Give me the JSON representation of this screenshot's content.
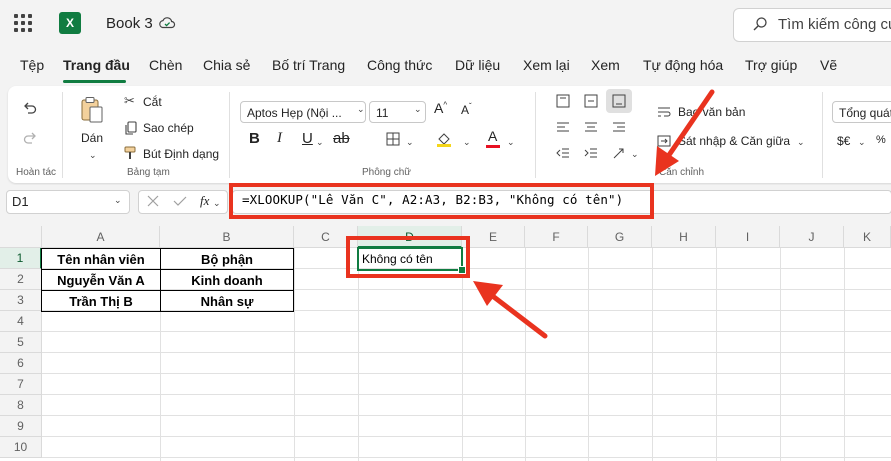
{
  "titlebar": {
    "book_title": "Book 3",
    "search_placeholder": "Tìm kiếm công cụ,"
  },
  "tabs": [
    {
      "label": "Tệp"
    },
    {
      "label": "Trang đầu",
      "active": true
    },
    {
      "label": "Chèn"
    },
    {
      "label": "Chia sẻ"
    },
    {
      "label": "Bố trí Trang"
    },
    {
      "label": "Công thức"
    },
    {
      "label": "Dữ liệu"
    },
    {
      "label": "Xem lại"
    },
    {
      "label": "Xem"
    },
    {
      "label": "Tự động hóa"
    },
    {
      "label": "Trợ giúp"
    },
    {
      "label": "Vẽ"
    }
  ],
  "ribbon": {
    "undo_group_label": "Hoàn tác",
    "paste_label": "Dán",
    "cut_label": "Cắt",
    "copy_label": "Sao chép",
    "format_painter_label": "Bút Định dạng",
    "clipboard_group_label": "Bảng tạm",
    "font_name": "Aptos Hẹp (Nội ...",
    "font_size": "11",
    "font_group_label": "Phông chữ",
    "wrap_text_label": "Bao văn bản",
    "merge_center_label": "Sát nhập & Căn giữa",
    "alignment_group_label": "Căn chỉnh",
    "number_format": "Tổng quát",
    "currency_label": "$€"
  },
  "formula_bar": {
    "name_box": "D1",
    "fx_label": "fx",
    "formula": "=XLOOKUP(\"Lê Văn C\", A2:A3, B2:B3, \"Không có tên\")"
  },
  "grid": {
    "columns": [
      "A",
      "B",
      "C",
      "D",
      "E",
      "F",
      "G",
      "H",
      "I",
      "J",
      "K"
    ],
    "selected_column": "D",
    "rows": [
      "1",
      "2",
      "3",
      "4",
      "5",
      "6",
      "7",
      "8",
      "9",
      "10"
    ],
    "selected_row": "1",
    "cells": {
      "A1": "Tên nhân viên",
      "B1": "Bộ phận",
      "A2": "Nguyễn Văn A",
      "B2": "Kinh doanh",
      "A3": "Trần Thị B",
      "B3": "Nhân sự",
      "D1": "Không có tên"
    }
  },
  "colors": {
    "accent": "#107c41",
    "highlight": "#e9331f"
  }
}
